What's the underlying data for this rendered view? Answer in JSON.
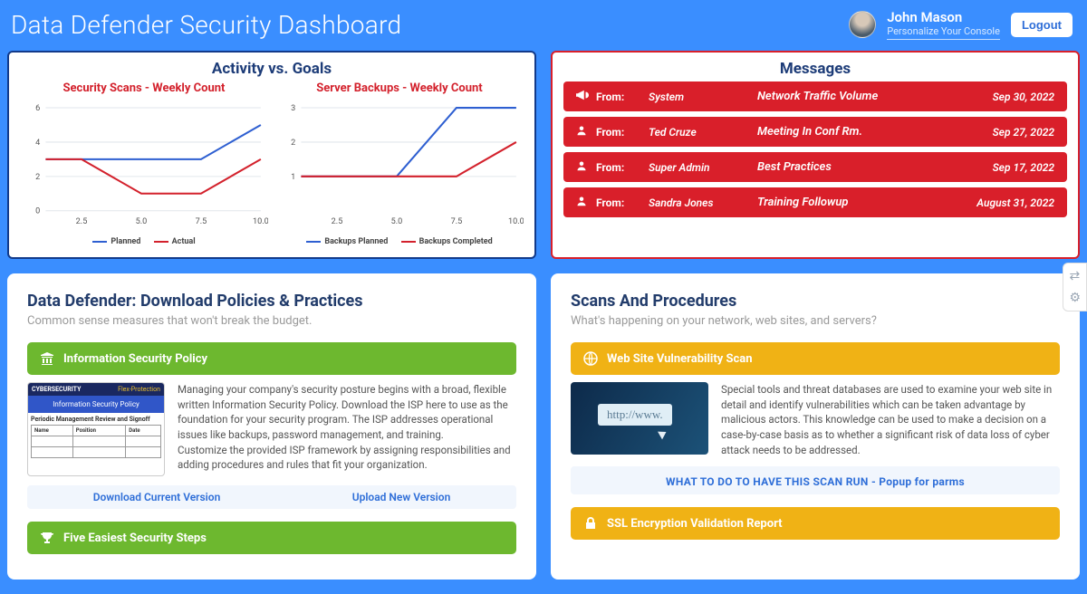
{
  "header": {
    "title": "Data Defender Security Dashboard",
    "user_name": "John Mason",
    "user_sub": "Personalize Your Console",
    "logout": "Logout"
  },
  "activity": {
    "title": "Activity vs. Goals",
    "chart1_title": "Security Scans - Weekly Count",
    "chart2_title": "Server Backups - Weekly Count",
    "legend1_a": "Planned",
    "legend1_b": "Actual",
    "legend2_a": "Backups Planned",
    "legend2_b": "Backups Completed"
  },
  "chart_data": [
    {
      "type": "line",
      "title": "Security Scans - Weekly Count",
      "x": [
        1,
        2.5,
        5.0,
        7.5,
        10.0
      ],
      "series": [
        {
          "name": "Planned",
          "color": "#2e5fd1",
          "values": [
            3,
            3,
            3,
            3,
            5
          ]
        },
        {
          "name": "Actual",
          "color": "#d3212c",
          "values": [
            3,
            3,
            1,
            1,
            3
          ]
        }
      ],
      "ylim": [
        0,
        6
      ],
      "xticks": [
        2.5,
        5.0,
        7.5,
        10.0
      ],
      "yticks": [
        0,
        2,
        4,
        6
      ]
    },
    {
      "type": "line",
      "title": "Server Backups - Weekly Count",
      "x": [
        1,
        2.5,
        5.0,
        7.5,
        10.0
      ],
      "series": [
        {
          "name": "Backups Planned",
          "color": "#2e5fd1",
          "values": [
            1,
            1,
            1,
            3,
            3
          ]
        },
        {
          "name": "Backups Completed",
          "color": "#d3212c",
          "values": [
            1,
            1,
            1,
            1,
            2
          ]
        }
      ],
      "ylim": [
        0,
        3
      ],
      "xticks": [
        2.5,
        5.0,
        7.5,
        10.0
      ],
      "yticks": [
        1,
        2,
        3
      ]
    }
  ],
  "messages": {
    "title": "Messages",
    "from_label": "From:",
    "items": [
      {
        "icon": "bullhorn",
        "sender": "System",
        "subject": "Network Traffic Volume",
        "date": "Sep 30, 2022"
      },
      {
        "icon": "user",
        "sender": "Ted Cruze",
        "subject": "Meeting In Conf Rm.",
        "date": "Sep 27, 2022"
      },
      {
        "icon": "user",
        "sender": "Super Admin",
        "subject": "Best Practices",
        "date": "Sep 17, 2022"
      },
      {
        "icon": "user",
        "sender": "Sandra Jones",
        "subject": "Training Followup",
        "date": "August 31, 2022"
      }
    ]
  },
  "policies": {
    "title": "Data Defender: Download Policies & Practices",
    "sub": "Common sense measures that won't break the budget.",
    "band1": "Information Security Policy",
    "thumb_top": "CYBERSECURITY",
    "thumb_brand": "Flex-Protection",
    "thumb_mid": "Information Security Policy",
    "thumb_section": "Periodic Management Review and Signoff",
    "thumb_h1": "Name",
    "thumb_h2": "Position",
    "thumb_h3": "Date",
    "desc1a": "Managing your company's security posture begins with a broad, flexible written Information Security Policy. Download the ISP here to use as the foundation for your security program. The ISP addresses operational issues like backups, password management, and training.",
    "desc1b": "Customize the provided ISP framework by assigning responsibilities and adding procedures and rules that fit your organization.",
    "link_download": "Download Current Version",
    "link_upload": "Upload New Version",
    "band2": "Five Easiest Security Steps"
  },
  "scans": {
    "title": "Scans And Procedures",
    "sub": "What's happening on your network, web sites, and servers?",
    "band1": "Web Site Vulnerability Scan",
    "addr": "http://www.",
    "desc": "Special tools and threat databases are used to examine your web site in detail and identify vulnerabilities which can be taken advantage by malicious actors. This knowledge can be used to make a decision on a case-by-case basis as to whether a significant risk of data loss of cyber attack needs to be addressed.",
    "action": "WHAT TO DO TO HAVE THIS SCAN RUN - Popup for parms",
    "band2": "SSL Encryption Validation Report"
  },
  "colors": {
    "blue": "#2e5fd1",
    "red": "#d3212c"
  }
}
